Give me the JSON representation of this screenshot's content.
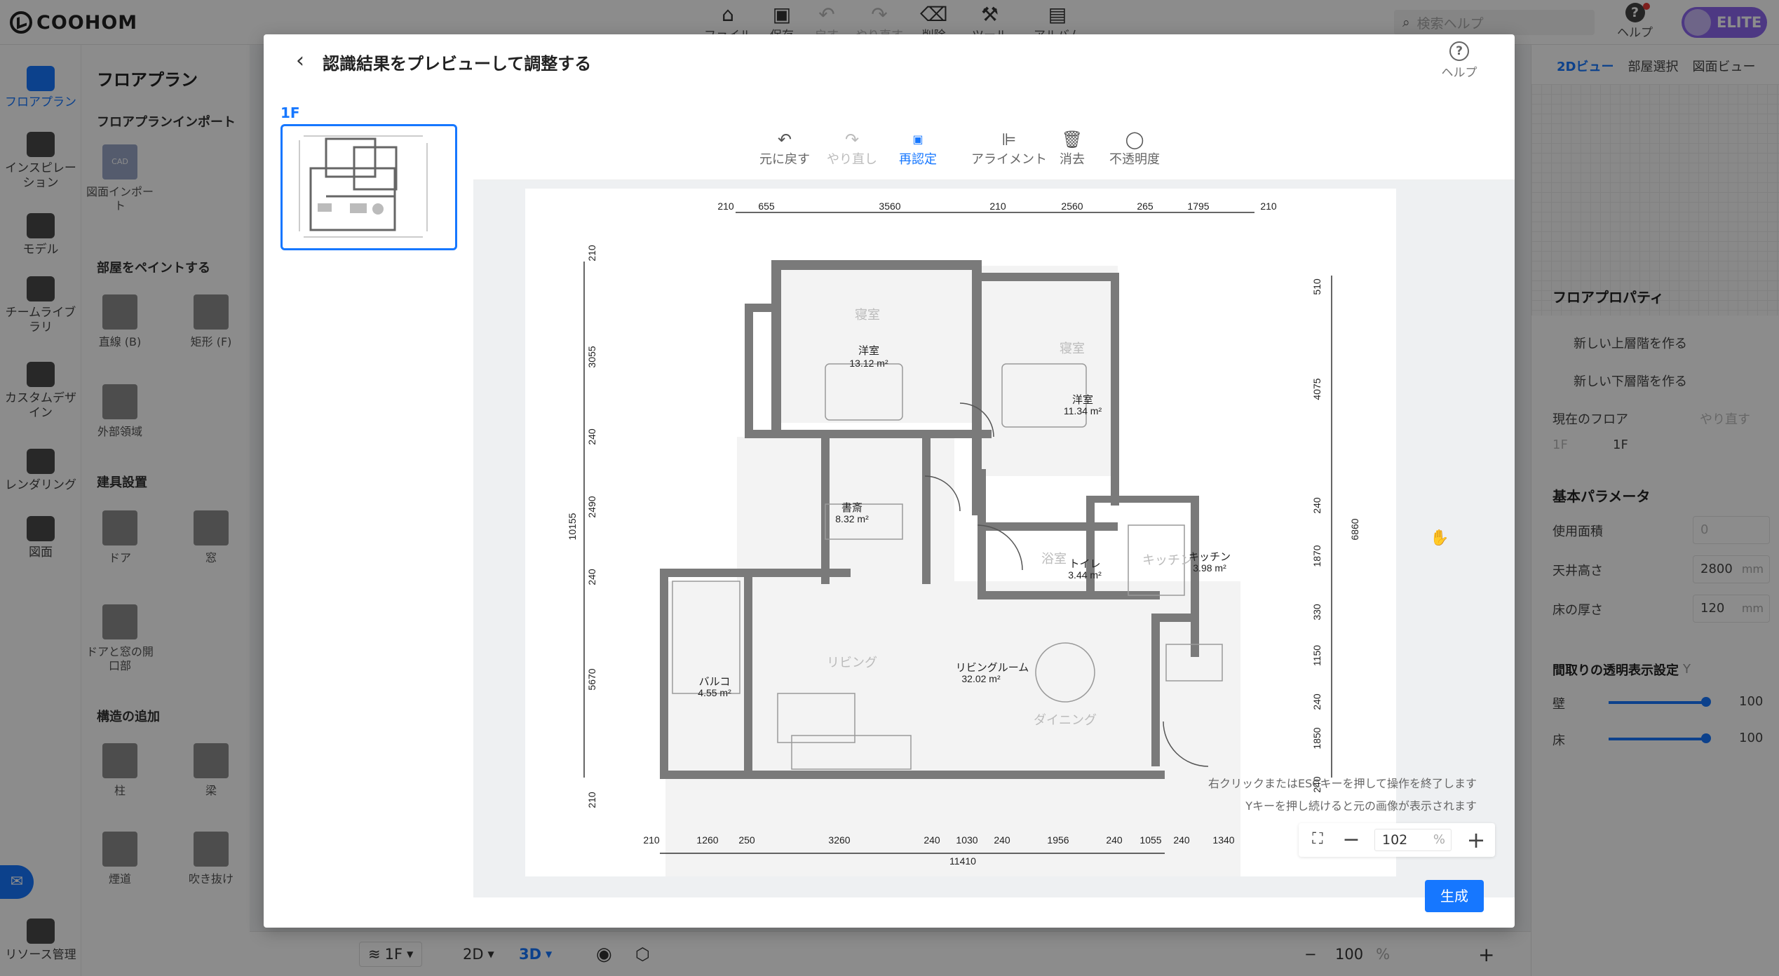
{
  "app": {
    "brand": "COOHOM",
    "menu": [
      {
        "label": "ファイル",
        "icon": "home-icon"
      },
      {
        "label": "保存",
        "icon": "save-icon"
      },
      {
        "label": "戻す",
        "icon": "undo-icon"
      },
      {
        "label": "やり直す",
        "icon": "redo-icon"
      },
      {
        "label": "削除",
        "icon": "eraser-icon"
      },
      {
        "label": "ツール",
        "icon": "wrench-icon"
      },
      {
        "label": "アルバム",
        "icon": "album-icon"
      }
    ],
    "search_placeholder": "検索ヘルプ",
    "help_label": "ヘルプ",
    "plan_badge": "ELITE"
  },
  "leftnav": [
    {
      "label": "フロアプラン",
      "active": true
    },
    {
      "label": "インスピレーション"
    },
    {
      "label": "モデル"
    },
    {
      "label": "チームライブラリ"
    },
    {
      "label": "カスタムデザイン"
    },
    {
      "label": "レンダリング"
    },
    {
      "label": "図面"
    },
    {
      "label": "リソース管理"
    }
  ],
  "leftpanel": {
    "title": "フロアプラン",
    "sec_import": "フロアプランインポート",
    "import_label": "図面インポート",
    "import_badge": "CAD",
    "sec_paint": "部屋をペイントする",
    "tool_line": "直線 (B)",
    "tool_rect": "矩形 (F)",
    "tool_outer": "外部領域",
    "sec_fixtures": "建具設置",
    "tool_door": "ドア",
    "tool_window": "窓",
    "tool_opening": "ドアと窓の開口部",
    "sec_structure": "構造の追加",
    "tool_column": "柱",
    "tool_beam": "梁",
    "tool_flue": "煙道",
    "tool_void": "吹き抜け"
  },
  "rightpanel": {
    "tabs": [
      "2Dビュー",
      "部屋選択",
      "図面ビュー"
    ],
    "floor_props": "フロアプロパティ",
    "new_upper": "新しい上層階を作る",
    "new_lower": "新しい下層階を作る",
    "current_floor": "現在のフロア",
    "undo_label": "やり直す",
    "floor_select": "1F",
    "floor_value": "1F",
    "basic_params": "基本パラメータ",
    "area_label": "使用面積",
    "area_value": "0",
    "ceiling_label": "天井高さ",
    "ceiling_value": "2800",
    "floor_thick_label": "床の厚さ",
    "floor_thick_value": "120",
    "unit_mm": "mm",
    "transparency_title": "間取りの透明表示設定",
    "transparency_key": "Y",
    "wall_label": "壁",
    "wall_value": "100",
    "floor_label": "床",
    "floor_pct": "100",
    "pct": "%"
  },
  "bottombar": {
    "floor": "1F",
    "mode_2d": "2D",
    "mode_3d": "3D",
    "zoom": "100",
    "pct": "%"
  },
  "dialog": {
    "title": "認識結果をプレビューして調整する",
    "help": "ヘルプ",
    "floor_label": "1F",
    "toolbar": [
      {
        "label": "元に戻す",
        "icon": "undo-icon",
        "state": "normal"
      },
      {
        "label": "やり直し",
        "icon": "redo-icon",
        "state": "disabled"
      },
      {
        "label": "再認定",
        "icon": "ai-recognize-icon",
        "state": "active"
      },
      {
        "label": "アライメント",
        "icon": "align-icon",
        "state": "normal"
      },
      {
        "label": "消去",
        "icon": "trash-icon",
        "state": "normal"
      },
      {
        "label": "不透明度",
        "icon": "opacity-icon",
        "state": "normal"
      }
    ],
    "hint_right_click": "右クリックまたはESCキーを押して操作を終了します",
    "hint_y_key": "Yキーを押し続けると元の画像が表示されます",
    "zoom_value": "102",
    "zoom_unit": "%",
    "generate": "生成"
  },
  "floorplan": {
    "rooms": [
      {
        "name": "寝室",
        "sub": "洋室",
        "area": "13.12 m²"
      },
      {
        "name": "寝室",
        "sub": "洋室",
        "area": "11.34 m²"
      },
      {
        "name": "書斎",
        "area": "8.32 m²"
      },
      {
        "name": "浴室",
        "sub": "トイレ",
        "area": "3.44 m²"
      },
      {
        "name": "キッチン",
        "sub": "キッチン",
        "area": "3.98 m²"
      },
      {
        "name": "リビング",
        "sub": "リビングルーム",
        "area": "32.02 m²"
      },
      {
        "name": "ダイニング"
      },
      {
        "name": "バルコ",
        "area": "4.55 m²"
      }
    ],
    "dims_top": [
      "210",
      "655",
      "3560",
      "210",
      "2560",
      "265",
      "1795",
      "210"
    ],
    "dims_bottom": [
      "210",
      "1260",
      "250",
      "3260",
      "240",
      "1030",
      "240",
      "1956",
      "240",
      "1055",
      "240",
      "1340"
    ],
    "dims_bottom_total": "11410",
    "dims_left": [
      "210",
      "3055",
      "240",
      "2490",
      "240",
      "5670",
      "210"
    ],
    "dims_left_total": "10155",
    "dims_right": [
      "510",
      "4075",
      "240",
      "1870",
      "330",
      "1150",
      "240",
      "1850",
      "240"
    ],
    "dims_right_total": "6860"
  }
}
